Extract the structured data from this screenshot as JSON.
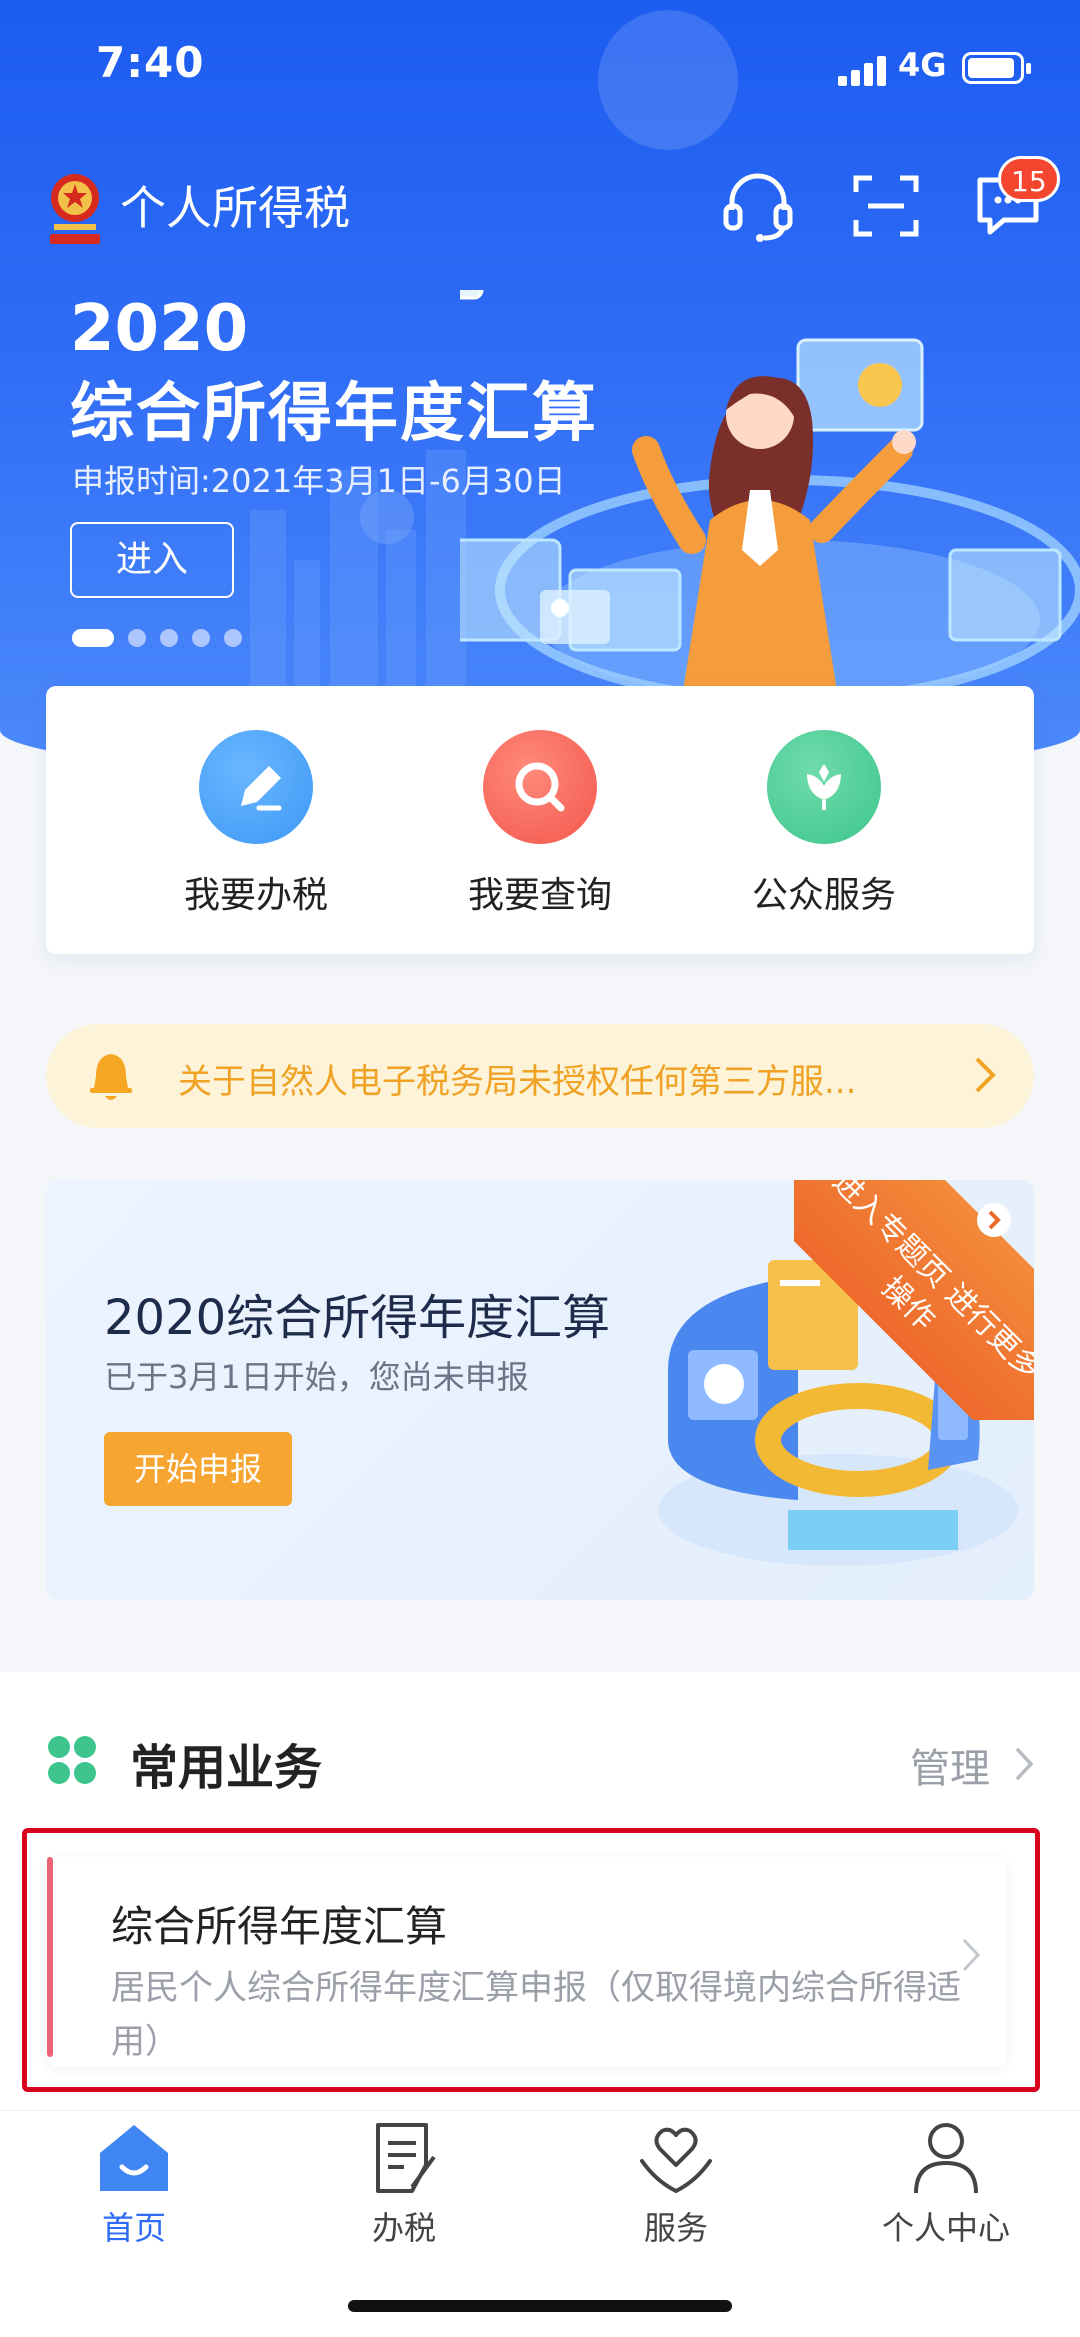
{
  "status_bar": {
    "time": "7:40",
    "network": "4G"
  },
  "header": {
    "title": "个人所得税",
    "message_badge": "15"
  },
  "banner": {
    "year": "2020",
    "title": "综合所得年度汇算",
    "date_text": "申报时间:2021年3月1日-6月30日",
    "enter_label": "进入",
    "slide_count": 5,
    "active_slide": 1
  },
  "quick_actions": [
    {
      "label": "我要办税",
      "icon": "pencil-icon",
      "color": "#3e98f6"
    },
    {
      "label": "我要查询",
      "icon": "search-icon",
      "color": "#f2574c"
    },
    {
      "label": "公众服务",
      "icon": "leaf-icon",
      "color": "#3ec58e"
    }
  ],
  "notice": {
    "text": "关于自然人电子税务局未授权任何第三方服..."
  },
  "promo": {
    "title": "2020综合所得年度汇算",
    "subtitle": "已于3月1日开始，您尚未申报",
    "button_label": "开始申报",
    "ribbon_text": "进入专题页 进行更多操作"
  },
  "common_services": {
    "title": "常用业务",
    "manage_label": "管理",
    "items": [
      {
        "title": "综合所得年度汇算",
        "description": "居民个人综合所得年度汇算申报（仅取得境内综合所得适用）"
      }
    ]
  },
  "tabbar": {
    "tabs": [
      {
        "label": "首页",
        "icon": "home-icon",
        "active": true
      },
      {
        "label": "办税",
        "icon": "document-icon",
        "active": false
      },
      {
        "label": "服务",
        "icon": "heart-hand-icon",
        "active": false
      },
      {
        "label": "个人中心",
        "icon": "person-icon",
        "active": false
      }
    ]
  },
  "colors": {
    "brand_blue": "#2f6cf6",
    "notice_bg": "#fdf3d9",
    "notice_text": "#f0a224",
    "promo_button": "#f6a531",
    "highlight_box": "#d9001b",
    "badge": "#f4462f"
  }
}
